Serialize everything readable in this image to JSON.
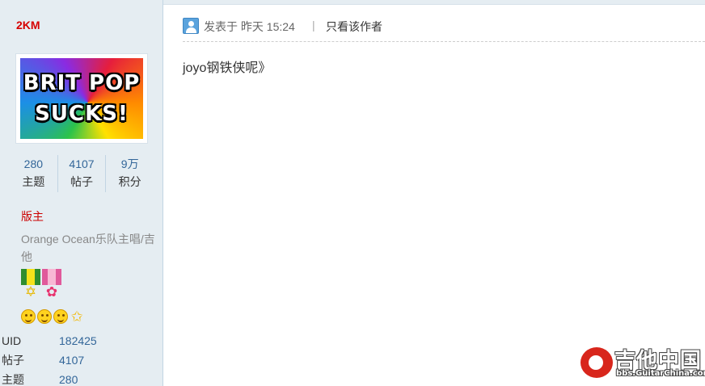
{
  "user": {
    "name": "2KM",
    "avatar_text_line1": "BRIT POP",
    "avatar_text_line2": "SUCKS!",
    "stats": [
      {
        "value": "280",
        "label": "主题"
      },
      {
        "value": "4107",
        "label": "帖子"
      },
      {
        "value": "9万",
        "label": "积分"
      }
    ],
    "role": "版主",
    "custom_title": "Orange Ocean乐队主唱/吉他",
    "medals": [
      "star-medal-icon",
      "flower-medal-icon"
    ],
    "level_icons": [
      "smiley-icon",
      "smiley-icon",
      "smiley-icon",
      "star-icon"
    ],
    "info": [
      {
        "key": "UID",
        "value": "182425"
      },
      {
        "key": "帖子",
        "value": "4107"
      },
      {
        "key": "主题",
        "value": "280"
      }
    ]
  },
  "post": {
    "posted_prefix": "发表于 昨天 15:24",
    "separator": "|",
    "author_only": "只看该作者",
    "content": "joyo钢铁侠呢》"
  },
  "watermark": {
    "title": "吉他中国",
    "url": "bbs.GuitarChina.com"
  },
  "colors": {
    "sidebar_bg": "#e5edf2",
    "username": "#d60000",
    "link": "#336699",
    "role": "#cc0000"
  }
}
